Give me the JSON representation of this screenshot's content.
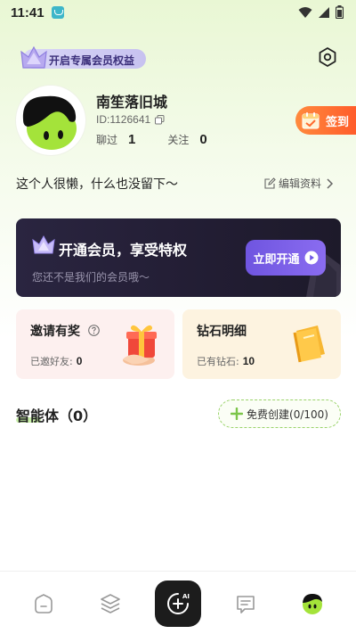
{
  "status_bar": {
    "time": "11:41"
  },
  "vip_badge": {
    "label": "开启专属会员权益"
  },
  "profile": {
    "username": "南笙落旧城",
    "user_id": "ID:1126641",
    "stats": [
      {
        "label": "聊过",
        "value": "1"
      },
      {
        "label": "关注",
        "value": "0"
      }
    ],
    "bio": "这个人很懒，什么也没留下～",
    "edit_label": "编辑资料"
  },
  "checkin": {
    "label": "签到"
  },
  "membership": {
    "title": "开通会员，享受特权",
    "subtitle": "您还不是我们的会员哦～",
    "button_label": "立即开通"
  },
  "invite": {
    "title": "邀请有奖",
    "sub_label": "已邀好友:",
    "count": "0"
  },
  "diamond": {
    "title": "钻石明细",
    "sub_label": "已有钻石:",
    "count": "10"
  },
  "agents": {
    "title": "智能体（0）",
    "create_label": "免费创建(0/100)"
  },
  "nav": {
    "center_badge": "AI"
  },
  "colors": {
    "accent_green": "#9ad36a",
    "vip_purple": "#7b62e8",
    "checkin_orange": "#ff6a2f"
  },
  "icons": [
    "wifi-icon",
    "signal-icon",
    "battery-icon",
    "settings-icon",
    "copy-icon",
    "calendar-icon",
    "edit-icon",
    "chevron-right-icon",
    "crown-icon",
    "play-icon",
    "help-icon",
    "gift-icon",
    "wallet-icon",
    "plus-icon",
    "home-icon",
    "layers-icon",
    "ai-create-icon",
    "message-icon",
    "profile-icon"
  ]
}
